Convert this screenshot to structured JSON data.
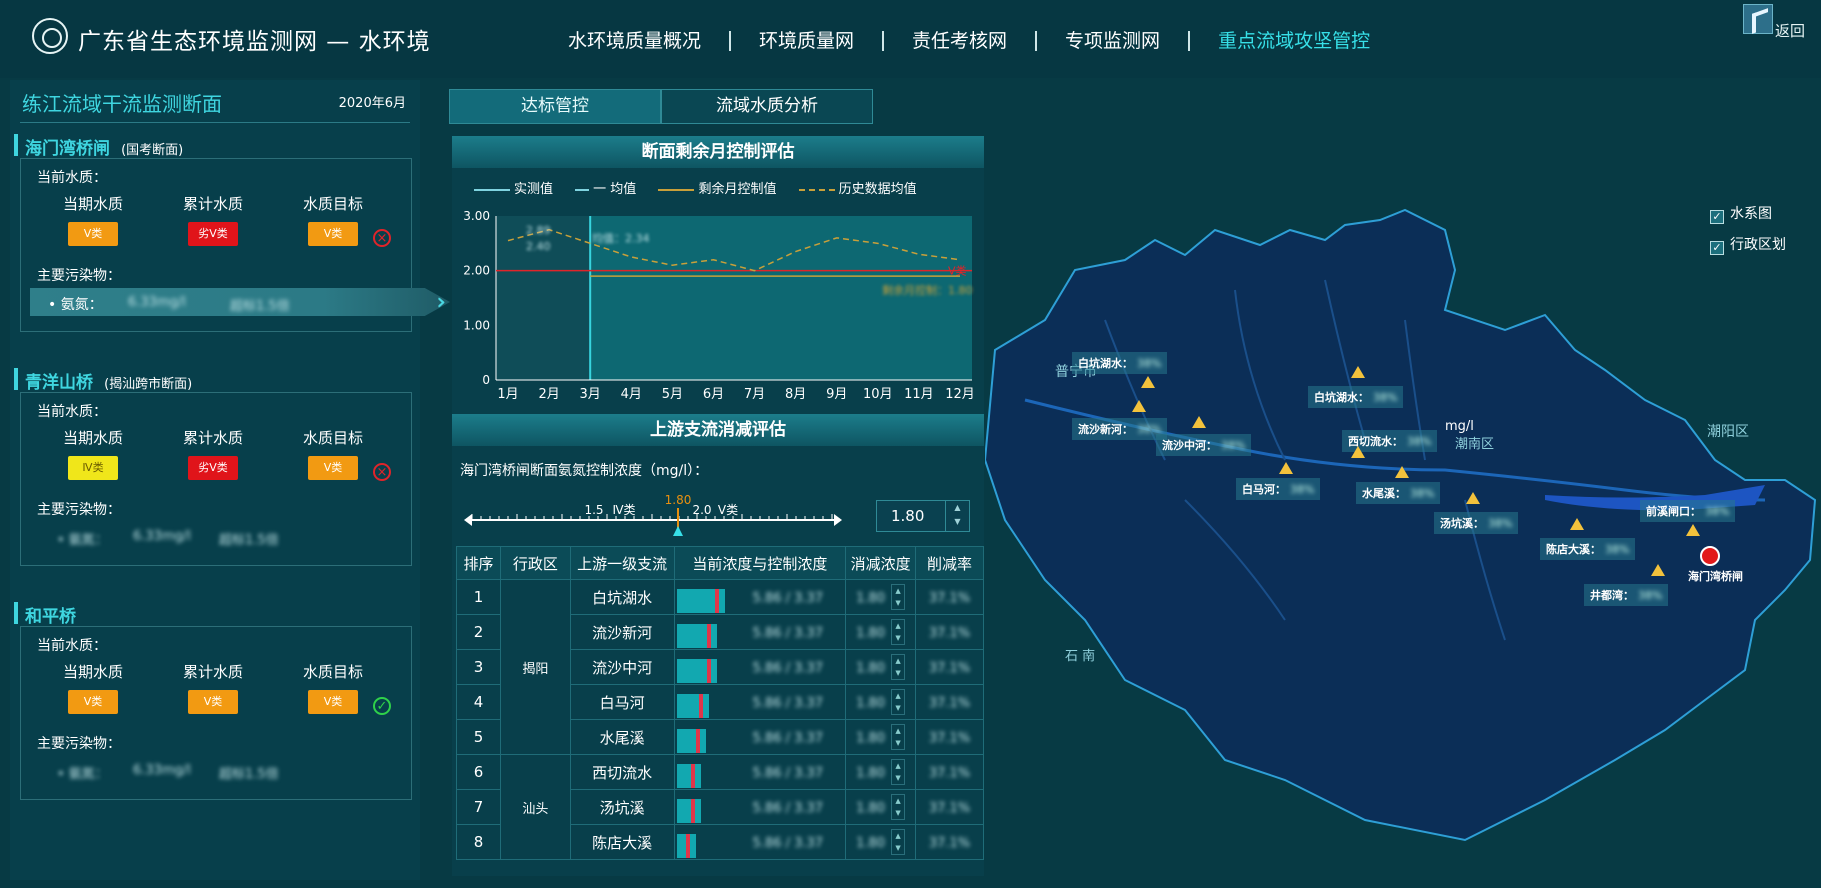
{
  "header": {
    "title": "广东省生态环境监测网 — 水环境",
    "nav": [
      "水环境质量概况",
      "环境质量网",
      "责任考核网",
      "专项监测网",
      "重点流域攻坚管控"
    ],
    "active_nav": "重点流域攻坚管控",
    "back_label": "返回"
  },
  "left": {
    "title": "练江流域干流监测断面",
    "date": "2020年6月",
    "labels": {
      "current": "当前水质：",
      "period": "当期水质",
      "cumulative": "累计水质",
      "target": "水质目标",
      "pollutants": "主要污染物："
    },
    "stations": [
      {
        "name": "海门湾桥闸",
        "type": "(国考断面)",
        "period": "Ⅴ类",
        "cumulative": "劣Ⅴ类",
        "target": "Ⅴ类",
        "met": false,
        "pollutant": "• 氨氮：",
        "value1": "6.33mg/l",
        "value2": "超标1.5倍"
      },
      {
        "name": "青洋山桥",
        "type": "(揭汕跨市断面)",
        "period": "Ⅳ类",
        "cumulative": "劣Ⅴ类",
        "target": "Ⅴ类",
        "met": false,
        "pollutant": "• 氨氮：",
        "value1": "6.33mg/l",
        "value2": "超标1.5倍"
      },
      {
        "name": "和平桥",
        "type": "",
        "period": "Ⅴ类",
        "cumulative": "Ⅴ类",
        "target": "Ⅴ类",
        "met": true,
        "pollutant": "• 氨氮：",
        "value1": "6.33mg/l",
        "value2": "超标1.5倍"
      }
    ]
  },
  "tabs": [
    "达标管控",
    "流域水质分析"
  ],
  "center": {
    "chart_title": "断面剩余月控制评估",
    "legend": [
      "实测值",
      "一 均值",
      "剩余月控制值",
      "历史数据均值"
    ],
    "upstream_title": "上游支流消减评估",
    "control_label": "海门湾桥闸断面氨氮控制浓度（mg/l）：",
    "slider": {
      "value": "1.80",
      "t1": "1.5",
      "t1b": "Ⅳ类",
      "t2": "2.0",
      "t2b": "Ⅴ类"
    },
    "stepper_value": "1.80",
    "table": {
      "headers": [
        "排序",
        "行政区",
        "上游一级支流",
        "当前浓度与控制浓度",
        "消减浓度",
        "削减率"
      ],
      "rows": [
        {
          "rank": "1",
          "name": "白坑湖水",
          "bar": 0.85
        },
        {
          "rank": "2",
          "name": "流沙新河",
          "bar": 0.72
        },
        {
          "rank": "3",
          "name": "流沙中河",
          "bar": 0.72
        },
        {
          "rank": "4",
          "name": "白马河",
          "bar": 0.58
        },
        {
          "rank": "5",
          "name": "水尾溪",
          "bar": 0.52
        },
        {
          "rank": "6",
          "name": "西切流水",
          "bar": 0.42
        },
        {
          "rank": "7",
          "name": "汤坑溪",
          "bar": 0.42
        },
        {
          "rank": "8",
          "name": "陈店大溪",
          "bar": 0.34
        }
      ],
      "regions": [
        "揭阳",
        "汕头"
      ],
      "blur_conc": "5.86 / 3.37",
      "blur_reduce": "1.80",
      "blur_rate": "37.1%"
    }
  },
  "chart_data": {
    "type": "line",
    "title": "断面剩余月控制评估",
    "categories": [
      "1月",
      "2月",
      "3月",
      "4月",
      "5月",
      "6月",
      "7月",
      "8月",
      "9月",
      "10月",
      "11月",
      "12月"
    ],
    "ylim": [
      0,
      3.0
    ],
    "yticks": [
      "0",
      "1.00",
      "2.00",
      "3.00"
    ],
    "series": [
      {
        "name": "历史数据均值",
        "values": [
          2.55,
          2.75,
          2.5,
          2.25,
          2.1,
          2.2,
          2.0,
          2.35,
          2.6,
          2.5,
          2.3,
          2.2
        ]
      },
      {
        "name": "剩余月控制值",
        "values": [
          null,
          null,
          1.9,
          1.9,
          1.9,
          1.9,
          1.9,
          1.9,
          1.9,
          1.9,
          1.9,
          1.9
        ]
      }
    ],
    "threshold": {
      "value": 2.0,
      "label": "Ⅴ类"
    },
    "blurred_labels": [
      "2.89",
      "2.40",
      "均值：2.34",
      "剩余月控制：1.80"
    ]
  },
  "map": {
    "layers": [
      "水系图",
      "行政区划"
    ],
    "stations": [
      {
        "name": "白坑湖水：",
        "v": "38%"
      },
      {
        "name": "流沙新河：",
        "v": "38%"
      },
      {
        "name": "流沙中河：",
        "v": "38%"
      },
      {
        "name": "白马河：",
        "v": "38%"
      },
      {
        "name": "白坑湖水：",
        "v": "38%"
      },
      {
        "name": "西切流水：",
        "v": "38%"
      },
      {
        "name": "水尾溪：",
        "v": "38%"
      },
      {
        "name": "汤坑溪：",
        "v": "38%"
      },
      {
        "name": "陈店大溪：",
        "v": "38%"
      },
      {
        "name": "井都湾：",
        "v": "38%"
      },
      {
        "name": "前溪闸口：",
        "v": "38%"
      }
    ],
    "target": "海门湾桥闸",
    "places": [
      "普宁市",
      "潮阳区",
      "潮南区",
      "mg/l",
      "石 南"
    ]
  }
}
